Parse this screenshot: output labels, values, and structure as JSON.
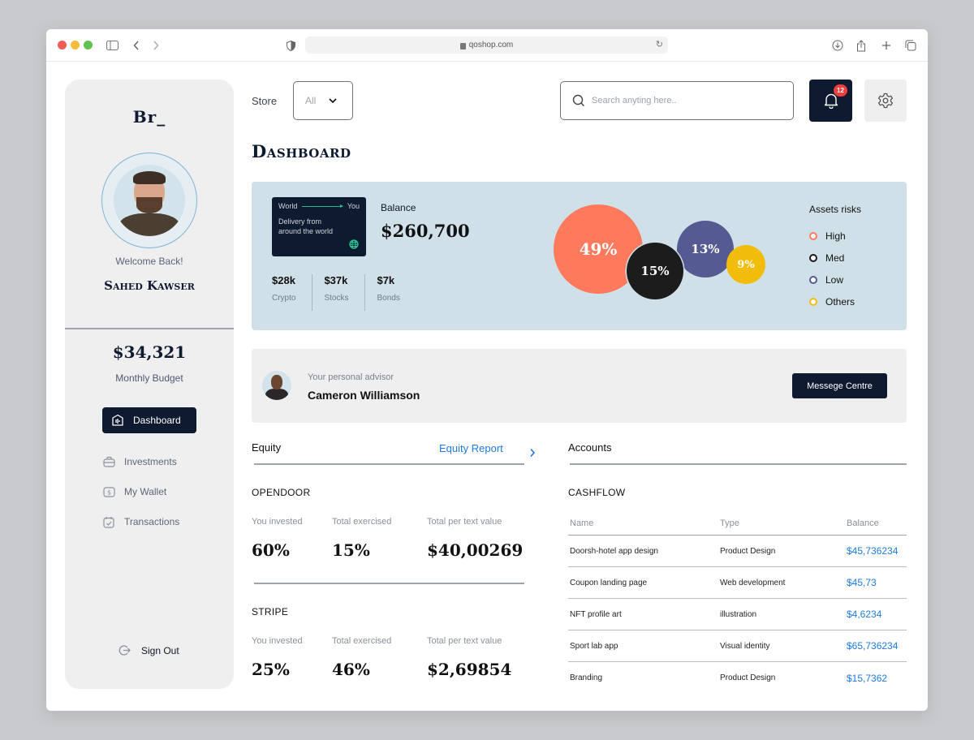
{
  "browser": {
    "url": "qoshop.com"
  },
  "sidebar": {
    "logo": "Br_",
    "welcome": "Welcome Back!",
    "user_name": "Sahed Kawser",
    "budget_value": "$34,321",
    "budget_label": "Monthly Budget",
    "nav": [
      {
        "label": "Dashboard",
        "icon": "dashboard-icon",
        "active": true
      },
      {
        "label": "Investments",
        "icon": "briefcase-icon",
        "active": false
      },
      {
        "label": "My Wallet",
        "icon": "wallet-icon",
        "active": false
      },
      {
        "label": "Transactions",
        "icon": "clipboard-check-icon",
        "active": false
      }
    ],
    "sign_out": "Sign Out"
  },
  "header": {
    "store_label": "Store",
    "store_value": "All",
    "search_placeholder": "Search anyting here..",
    "notification_count": "12"
  },
  "page_title": "Dashboard",
  "summary": {
    "delivery_card": {
      "from": "World",
      "to": "You",
      "text": "Delivery from around the world"
    },
    "balance_label": "Balance",
    "balance_value": "$260,700",
    "assets": [
      {
        "value": "$28k",
        "label": "Crypto"
      },
      {
        "value": "$37k",
        "label": "Stocks"
      },
      {
        "value": "$7k",
        "label": "Bonds"
      }
    ]
  },
  "chart_data": {
    "type": "bubble",
    "title": "Assets risks",
    "legend_position": "right",
    "categories": [
      "High",
      "Med",
      "Low",
      "Others"
    ],
    "values": [
      49,
      15,
      13,
      9
    ],
    "labels": [
      "49%",
      "15%",
      "13%",
      "9%"
    ],
    "colors": [
      "#ff7a5c",
      "#1c1c1c",
      "#565a92",
      "#f2bd0a"
    ]
  },
  "advisor": {
    "subtitle": "Your personal advisor",
    "name": "Cameron Williamson",
    "button": "Messege Centre"
  },
  "equity": {
    "title": "Equity",
    "report_link": "Equity Report",
    "companies": [
      {
        "name": "OPENDOOR",
        "labels": [
          "You invested",
          "Total exercised",
          "Total per text value"
        ],
        "values": [
          "60%",
          "15%",
          "$40,00269"
        ]
      },
      {
        "name": "STRIPE",
        "labels": [
          "You invested",
          "Total exercised",
          "Total per text value"
        ],
        "values": [
          "25%",
          "46%",
          "$2,69854"
        ]
      }
    ]
  },
  "accounts": {
    "title": "Accounts",
    "cashflow_title": "CASHFLOW",
    "columns": [
      "Name",
      "Type",
      "Balance"
    ],
    "rows": [
      {
        "name": "Doorsh-hotel app design",
        "type": "Product Design",
        "balance": "$45,736234"
      },
      {
        "name": "Coupon landing page",
        "type": "Web development",
        "balance": "$45,73"
      },
      {
        "name": "NFT profile art",
        "type": "illustration",
        "balance": "$4,6234"
      },
      {
        "name": "Sport lab app",
        "type": "Visual identity",
        "balance": "$65,736234"
      },
      {
        "name": "Branding",
        "type": "Product Design",
        "balance": "$15,7362"
      }
    ]
  }
}
